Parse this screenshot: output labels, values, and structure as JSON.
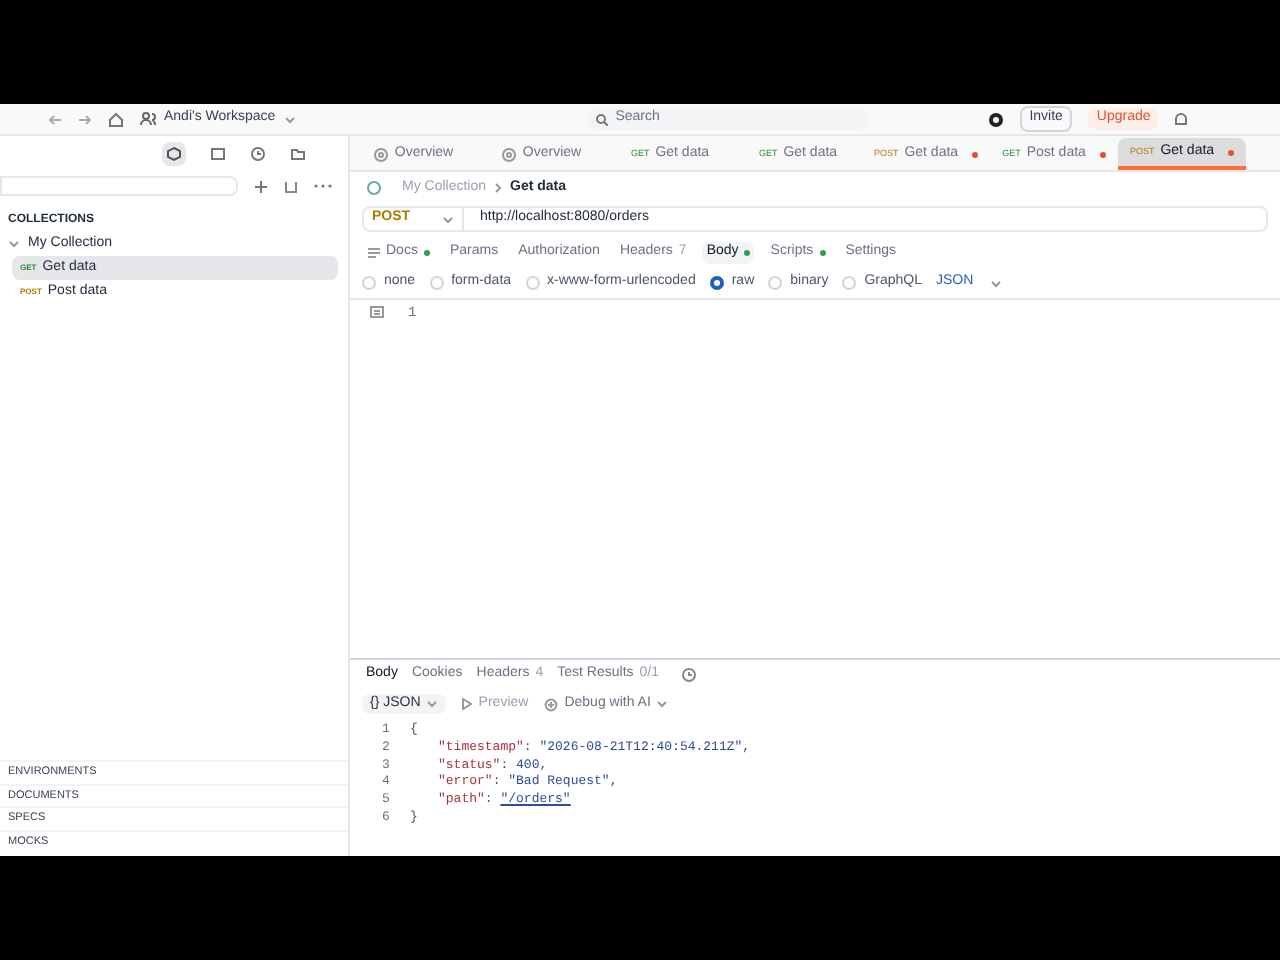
{
  "top_bar": {
    "workspace": "Andi's Workspace",
    "search": {
      "placeholder": "Search"
    },
    "invite": "Invite",
    "upgrade": "Upgrade"
  },
  "sidebar": {
    "section": "COLLECTIONS",
    "collection": {
      "name": "My Collection",
      "expanded": true,
      "children": [
        {
          "method": "GET",
          "name": "Get data",
          "selected": true
        },
        {
          "method": "POST",
          "name": "Post data",
          "selected": false
        }
      ]
    },
    "footer_sections": [
      "ENVIRONMENTS",
      "DOCUMENTS",
      "SPECS",
      "MOCKS"
    ]
  },
  "tabs": [
    {
      "kind": "overview",
      "label": "Overview",
      "selected": false,
      "unsaved": false
    },
    {
      "kind": "overview",
      "label": "Overview",
      "selected": false,
      "unsaved": false
    },
    {
      "kind": "request",
      "method": "GET",
      "label": "Get data",
      "selected": false,
      "unsaved": false
    },
    {
      "kind": "request",
      "method": "GET",
      "label": "Get data",
      "selected": false,
      "unsaved": false
    },
    {
      "kind": "request",
      "method": "POST",
      "label": "Get data",
      "selected": false,
      "unsaved": true
    },
    {
      "kind": "request",
      "method": "GET",
      "label": "Post data",
      "selected": false,
      "unsaved": true
    },
    {
      "kind": "request",
      "method": "POST",
      "label": "Get data",
      "selected": true,
      "unsaved": true
    }
  ],
  "breadcrumb": {
    "parent": "My Collection",
    "current": "Get data"
  },
  "request": {
    "method": "POST",
    "url": "http://localhost:8080/orders"
  },
  "request_tabs": [
    {
      "label": "Docs",
      "dot": true,
      "selected": false
    },
    {
      "label": "Params",
      "dot": false,
      "selected": false
    },
    {
      "label": "Authorization",
      "dot": false,
      "selected": false
    },
    {
      "label": "Headers",
      "count": "7",
      "dot": false,
      "selected": false
    },
    {
      "label": "Body",
      "dot": true,
      "selected": true
    },
    {
      "label": "Scripts",
      "dot": true,
      "selected": false
    },
    {
      "label": "Settings",
      "dot": false,
      "selected": false
    }
  ],
  "body_types": [
    {
      "label": "none",
      "selected": false
    },
    {
      "label": "form-data",
      "selected": false
    },
    {
      "label": "x-www-form-urlencoded",
      "selected": false
    },
    {
      "label": "raw",
      "selected": true
    },
    {
      "label": "binary",
      "selected": false
    },
    {
      "label": "GraphQL",
      "selected": false
    }
  ],
  "body_format": "JSON",
  "editor_lines": [
    "1"
  ],
  "response_tabs": [
    {
      "label": "Body",
      "selected": true
    },
    {
      "label": "Cookies",
      "selected": false
    },
    {
      "label": "Headers",
      "count": "4",
      "selected": false
    },
    {
      "label": "Test Results",
      "count": "0/1",
      "selected": false
    }
  ],
  "response_toolbar": {
    "format_icon": "{}",
    "format": "JSON",
    "preview": "Preview",
    "debug": "Debug with AI"
  },
  "response_lines": [
    {
      "number": "1",
      "segments": [
        {
          "kind": "punct",
          "text": "{"
        }
      ]
    },
    {
      "number": "2",
      "segments": [
        {
          "kind": "key",
          "text": "\"timestamp\""
        },
        {
          "kind": "punct",
          "text": ": "
        },
        {
          "kind": "string",
          "text": "\"2026-08-21T12:40:54.211Z\""
        },
        {
          "kind": "punct",
          "text": ","
        }
      ]
    },
    {
      "number": "3",
      "segments": [
        {
          "kind": "key",
          "text": "\"status\""
        },
        {
          "kind": "punct",
          "text": ": "
        },
        {
          "kind": "number",
          "text": "400"
        },
        {
          "kind": "punct",
          "text": ","
        }
      ]
    },
    {
      "number": "4",
      "segments": [
        {
          "kind": "key",
          "text": "\"error\""
        },
        {
          "kind": "punct",
          "text": ": "
        },
        {
          "kind": "string",
          "text": "\"Bad Request\""
        },
        {
          "kind": "punct",
          "text": ","
        }
      ]
    },
    {
      "number": "5",
      "segments": [
        {
          "kind": "key",
          "text": "\"path\""
        },
        {
          "kind": "punct",
          "text": ": "
        },
        {
          "kind": "link",
          "text": "\"/orders\""
        }
      ]
    },
    {
      "number": "6",
      "segments": [
        {
          "kind": "punct",
          "text": "}"
        }
      ]
    }
  ]
}
